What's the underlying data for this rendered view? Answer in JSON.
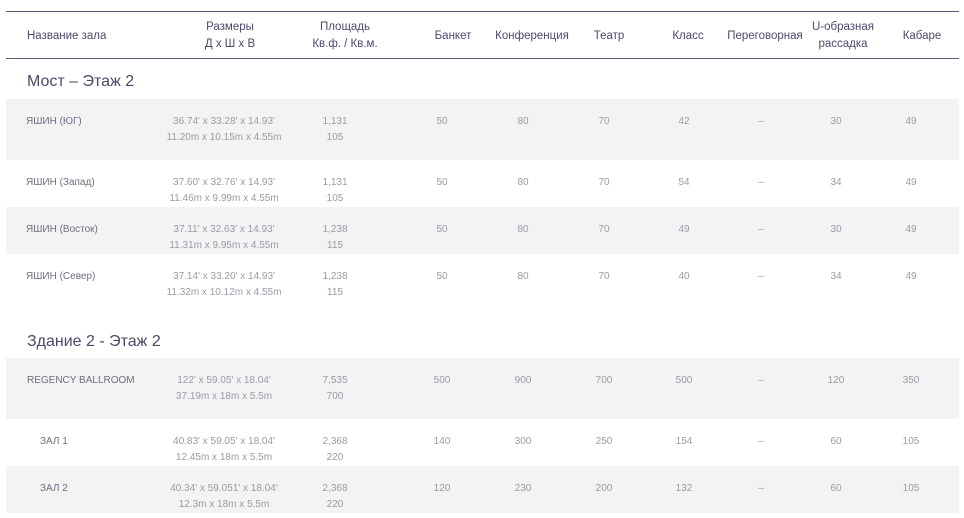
{
  "header": {
    "cols": [
      "Название зала",
      "Размеры\nД x Ш x В",
      "Площадь\nКв.ф. / Кв.м.",
      "Банкет",
      "Конференция",
      "Театр",
      "Класс",
      "Переговорная",
      "U-образная\nрассадка",
      "Кабаре"
    ]
  },
  "sections": [
    {
      "title": "Мост – Этаж 2",
      "rows": [
        {
          "name": "ЯШИН (ЮГ)",
          "dims": "36.74' x 33.28' x 14.93'\n11.20m x 10.15m x 4.55m",
          "area": "1,131\n105",
          "banquet": "50",
          "conference": "80",
          "theater": "70",
          "class": "42",
          "boardroom": "–",
          "ushape": "30",
          "cabaret": "49"
        },
        {
          "name": "ЯШИН (Запад)",
          "dims": "37.60' x 32.76' x 14.93'\n11.46m x 9.99m x 4.55m",
          "area": "1,131\n105",
          "banquet": "50",
          "conference": "80",
          "theater": "70",
          "class": "54",
          "boardroom": "–",
          "ushape": "34",
          "cabaret": "49"
        },
        {
          "name": "ЯШИН  (Восток)",
          "dims": "37.11' x 32.63' x 14.93'\n11.31m x 9.95m x 4.55m",
          "area": "1,238\n115",
          "banquet": "50",
          "conference": "80",
          "theater": "70",
          "class": "49",
          "boardroom": "–",
          "ushape": "30",
          "cabaret": "49"
        },
        {
          "name": "ЯШИН  (Север)",
          "dims": "37.14' x 33.20' x 14.93'\n11.32m x 10.12m x 4.55m",
          "area": "1,238\n115",
          "banquet": "50",
          "conference": "80",
          "theater": "70",
          "class": "40",
          "boardroom": "–",
          "ushape": "34",
          "cabaret": "49"
        }
      ]
    },
    {
      "title": "Здание 2 - Этаж 2",
      "rows": [
        {
          "name": "REGENCY BALLROOM",
          "dims": "122' x 59.05' x 18.04'\n37.19m x 18m x 5.5m",
          "area": "7,535\n700",
          "banquet": "500",
          "conference": "900",
          "theater": "700",
          "class": "500",
          "boardroom": "–",
          "ushape": "120",
          "cabaret": "350"
        },
        {
          "name": "ЗАЛ 1",
          "dims": "40.83' x 59.05' x 18.04'\n12.45m x 18m x 5.5m",
          "area": "2,368\n220",
          "banquet": "140",
          "conference": "300",
          "theater": "250",
          "class": "154",
          "boardroom": "–",
          "ushape": "60",
          "cabaret": "105"
        },
        {
          "name": "ЗАЛ 2",
          "dims": "40.34' x 59.051' x 18.04'\n12.3m x 18m x 5.5m",
          "area": "2,368\n220",
          "banquet": "120",
          "conference": "230",
          "theater": "200",
          "class": "132",
          "boardroom": "–",
          "ushape": "60",
          "cabaret": "105"
        }
      ]
    }
  ]
}
